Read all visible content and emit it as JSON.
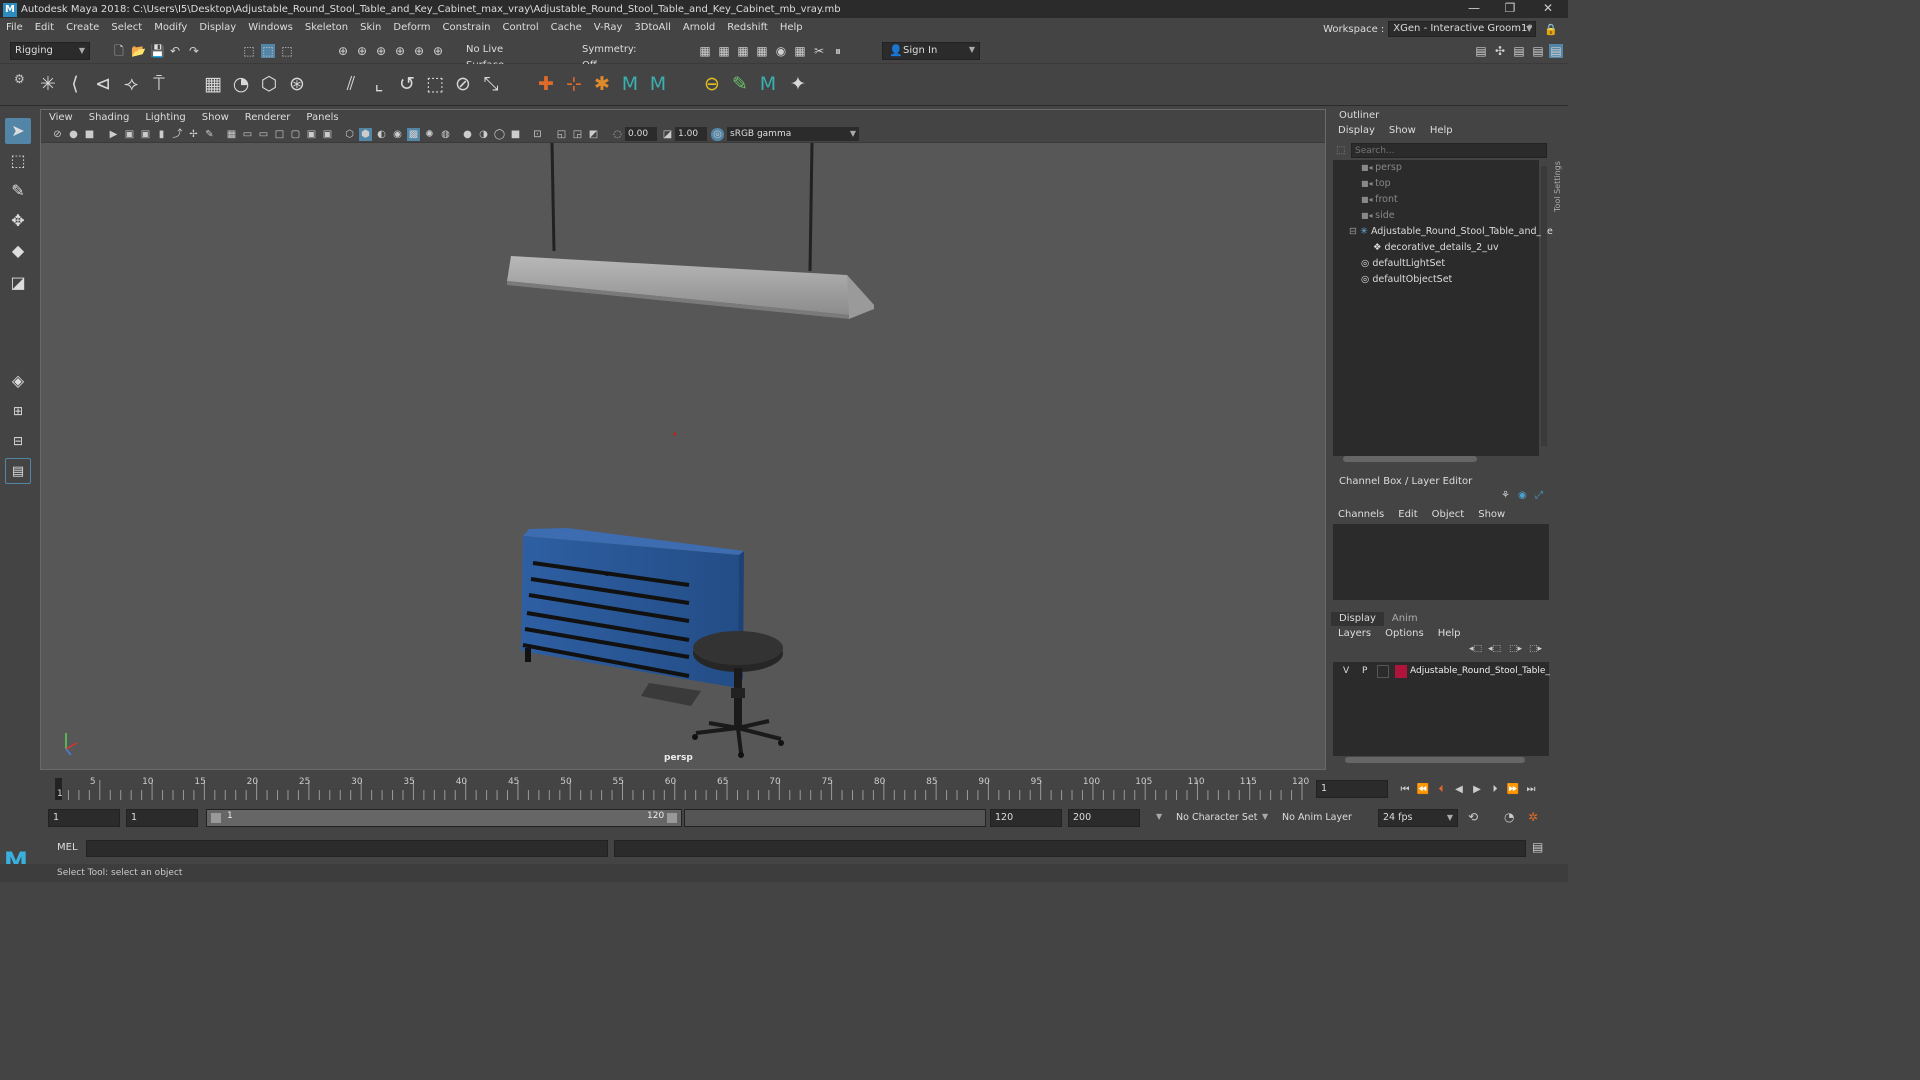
{
  "window": {
    "app_icon": "M",
    "title": "Autodesk Maya 2018: C:\\Users\\I5\\Desktop\\Adjustable_Round_Stool_Table_and_Key_Cabinet_max_vray\\Adjustable_Round_Stool_Table_and_Key_Cabinet_mb_vray.mb",
    "minimize": "—",
    "restore": "❐",
    "close": "✕"
  },
  "menu": [
    "File",
    "Edit",
    "Create",
    "Select",
    "Modify",
    "Display",
    "Windows",
    "Skeleton",
    "Skin",
    "Deform",
    "Constrain",
    "Control",
    "Cache",
    "V-Ray",
    "3DtoAll",
    "Arnold",
    "Redshift",
    "Help"
  ],
  "workspace": {
    "label": "Workspace :",
    "value": "XGen - Interactive Groom1*"
  },
  "status": {
    "menuset": "Rigging",
    "live_surface": "No Live Surface",
    "symmetry": "Symmetry: Off",
    "signin": "Sign In"
  },
  "viewport": {
    "menus": [
      "View",
      "Shading",
      "Lighting",
      "Show",
      "Renderer",
      "Panels"
    ],
    "exposure": "0.00",
    "gamma": "1.00",
    "colorspace": "sRGB gamma",
    "camera_label": "persp"
  },
  "outliner": {
    "title": "Outliner",
    "menus": [
      "Display",
      "Show",
      "Help"
    ],
    "search_placeholder": "Search...",
    "items": [
      {
        "label": "persp",
        "dim": true
      },
      {
        "label": "top",
        "dim": true
      },
      {
        "label": "front",
        "dim": true
      },
      {
        "label": "side",
        "dim": true
      },
      {
        "label": "Adjustable_Round_Stool_Table_and_Ke",
        "dim": false
      },
      {
        "label": "decorative_details_2_uv",
        "dim": false
      },
      {
        "label": "defaultLightSet",
        "dim": false
      },
      {
        "label": "defaultObjectSet",
        "dim": false
      }
    ]
  },
  "channelbox": {
    "title": "Channel Box / Layer Editor",
    "menus": [
      "Channels",
      "Edit",
      "Object",
      "Show"
    ]
  },
  "layers": {
    "tabs": [
      "Display",
      "Anim"
    ],
    "menus": [
      "Layers",
      "Options",
      "Help"
    ],
    "layer": {
      "v": "V",
      "p": "P",
      "name": "Adjustable_Round_Stool_Table_",
      "color": "#b0143a"
    }
  },
  "timeline": {
    "ticks": [
      "5",
      "10",
      "15",
      "20",
      "25",
      "30",
      "35",
      "40",
      "45",
      "50",
      "55",
      "60",
      "65",
      "70",
      "75",
      "80",
      "85",
      "90",
      "95",
      "100",
      "105",
      "110",
      "115",
      "120"
    ],
    "start_tick": "1",
    "current_frame": "1"
  },
  "range": {
    "start": "1",
    "playback_start": "1",
    "slider_start": "1",
    "slider_end": "120",
    "playback_end": "120",
    "end": "200",
    "character_set": "No Character Set",
    "anim_layer": "No Anim Layer",
    "fps": "24 fps"
  },
  "command": {
    "mode": "MEL"
  },
  "help": {
    "text": "Select Tool: select an object"
  },
  "side_tab": "Tool Settings",
  "colors": {
    "accent": "#5285a6",
    "cabinet": "#2a5a9c"
  }
}
